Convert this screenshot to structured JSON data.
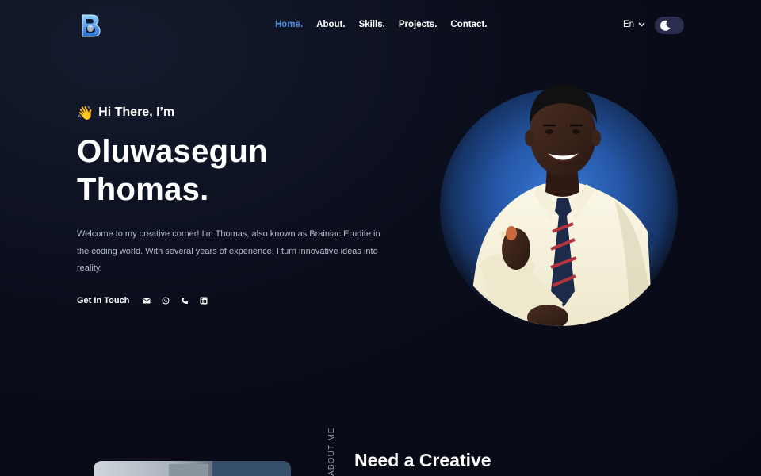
{
  "nav": {
    "links": [
      {
        "label": "Home.",
        "active": true
      },
      {
        "label": "About.",
        "active": false
      },
      {
        "label": "Skills.",
        "active": false
      },
      {
        "label": "Projects.",
        "active": false
      },
      {
        "label": "Contact.",
        "active": false
      }
    ],
    "language": "En",
    "theme_toggle_icon": "moon-icon",
    "logo_icon": "brand-logo-icon"
  },
  "hero": {
    "greeting_emoji": "👋",
    "greeting": "Hi There, I’m",
    "name_line1": "Oluwasegun",
    "name_line2": "Thomas.",
    "description": "Welcome to my creative corner! I'm Thomas, also known as Brainiac Erudite in the coding world. With several years of experience, I turn innovative ideas into reality.",
    "cta_label": "Get In Touch",
    "social_icons": [
      "email-icon",
      "whatsapp-icon",
      "phone-icon",
      "linkedin-icon"
    ]
  },
  "about": {
    "label": "ABOUT ME",
    "title": "Need a Creative"
  },
  "colors": {
    "background": "#0a0d1a",
    "accent": "#4a8fe0",
    "toggle_bg": "#2b2f4d",
    "glow": "#3a7ad6"
  }
}
